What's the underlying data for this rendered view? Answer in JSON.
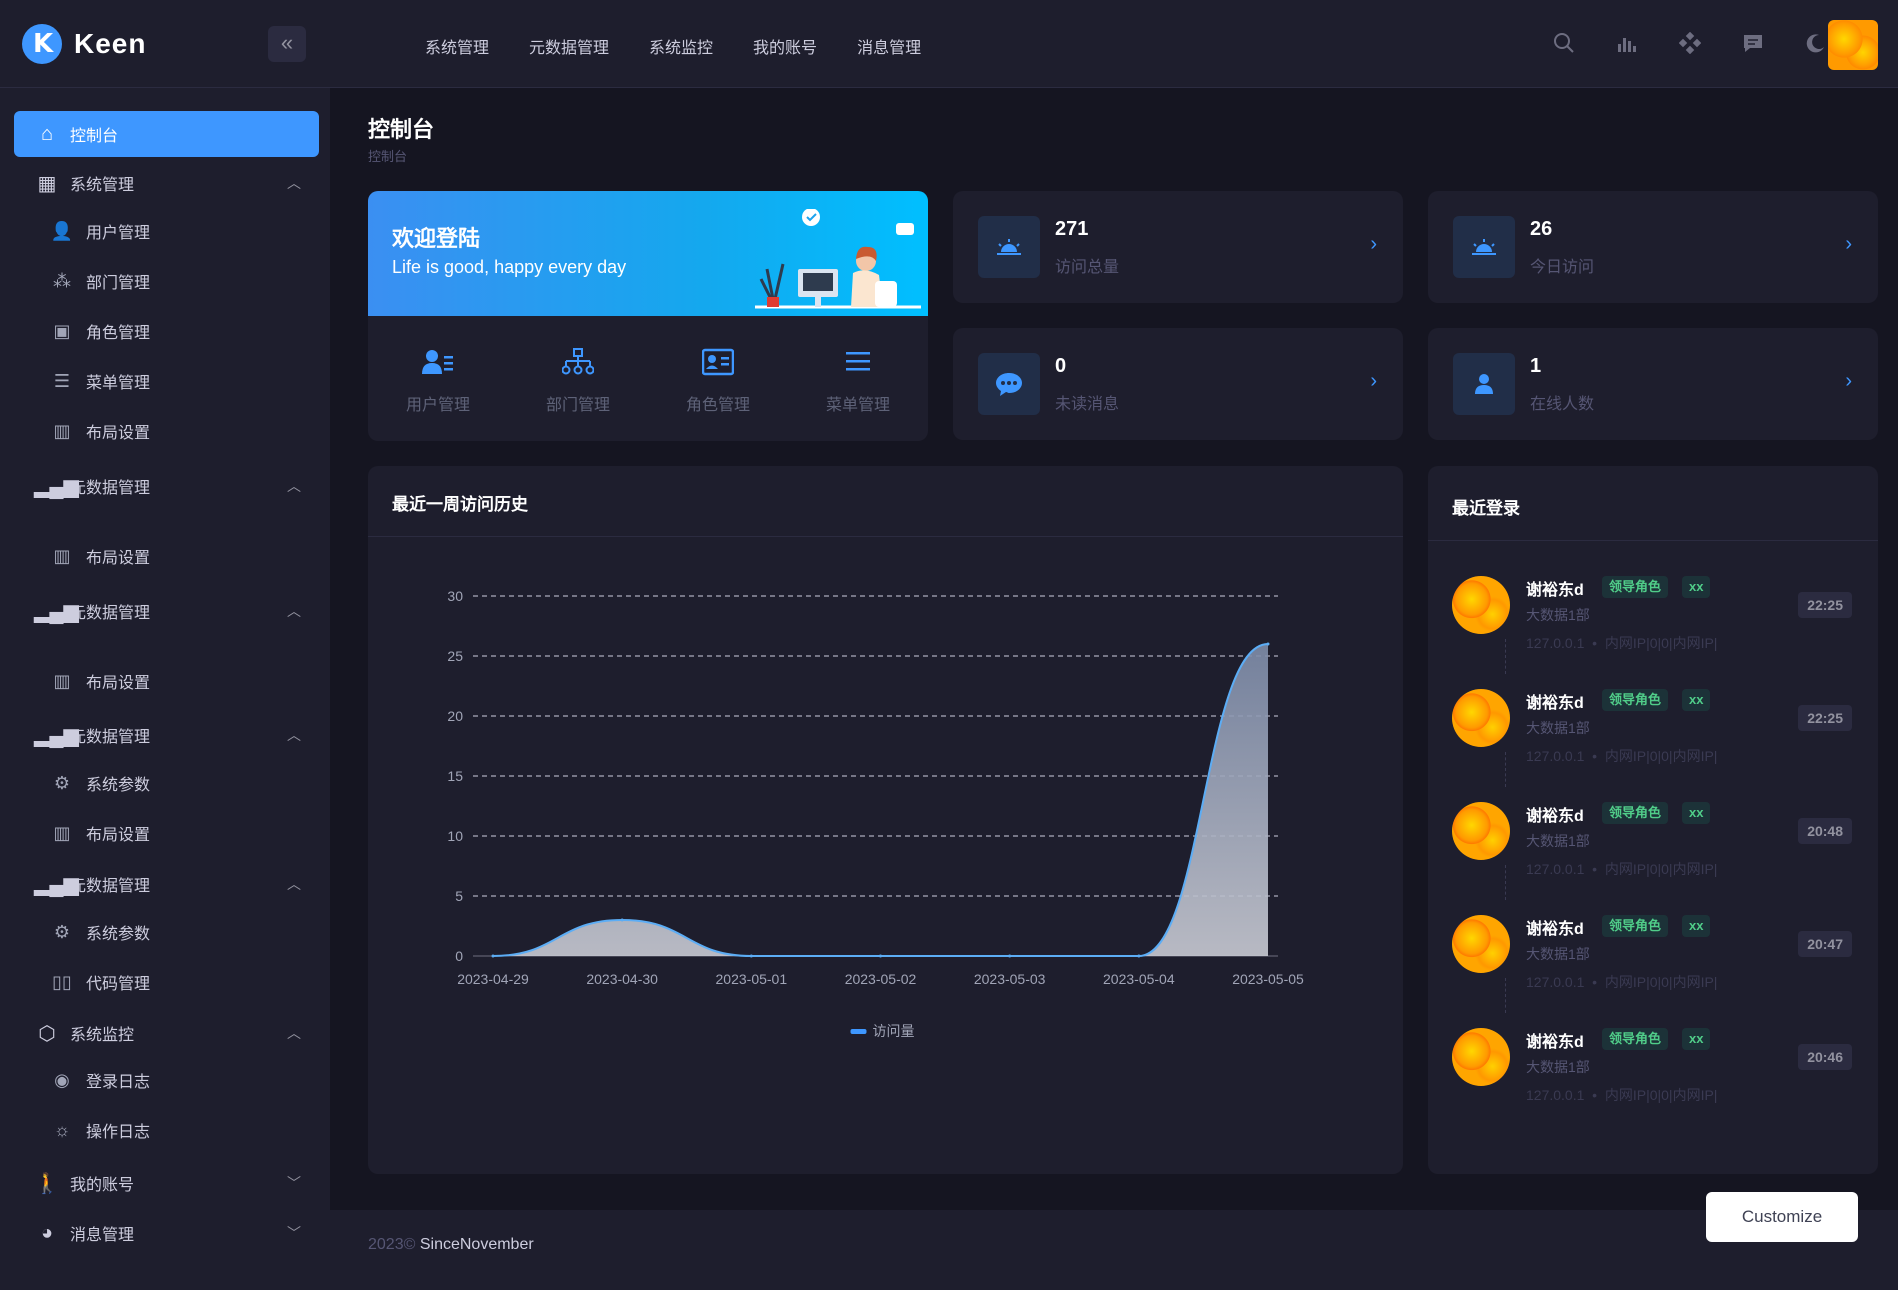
{
  "brand": {
    "name": "Keen",
    "accent": "#3e97ff"
  },
  "topnav": [
    "系统管理",
    "元数据管理",
    "系统监控",
    "我的账号",
    "消息管理"
  ],
  "top_icons": [
    "search-icon",
    "chart-icon",
    "apps-icon",
    "message-icon",
    "moon-icon"
  ],
  "sidebar": {
    "items": [
      {
        "label": "控制台",
        "icon": "home-icon",
        "active": true
      },
      {
        "label": "系统管理",
        "icon": "grid-icon",
        "expanded": true,
        "children": [
          {
            "label": "用户管理",
            "icon": "users-icon"
          },
          {
            "label": "部门管理",
            "icon": "org-icon"
          },
          {
            "label": "角色管理",
            "icon": "id-card-icon"
          },
          {
            "label": "菜单管理",
            "icon": "menu-icon"
          },
          {
            "label": "布局设置",
            "icon": "layout-icon"
          }
        ]
      },
      {
        "label": "元数据管理",
        "icon": "bar-chart-icon",
        "expanded": true,
        "children": [
          {
            "label": "布局设置",
            "icon": "layout-icon"
          }
        ]
      },
      {
        "label": "元数据管理",
        "icon": "bar-chart-icon",
        "expanded": true,
        "children": [
          {
            "label": "布局设置",
            "icon": "layout-icon"
          }
        ]
      },
      {
        "label": "元数据管理",
        "icon": "bar-chart-icon",
        "expanded": true,
        "children": [
          {
            "label": "系统参数",
            "icon": "gear-icon"
          },
          {
            "label": "布局设置",
            "icon": "layout-icon"
          }
        ]
      },
      {
        "label": "元数据管理",
        "icon": "bar-chart-icon",
        "expanded": true,
        "children": [
          {
            "label": "系统参数",
            "icon": "gear-icon"
          },
          {
            "label": "代码管理",
            "icon": "book-icon"
          }
        ]
      },
      {
        "label": "系统监控",
        "icon": "box-icon",
        "expanded": true,
        "children": [
          {
            "label": "登录日志",
            "icon": "fingerprint-icon"
          },
          {
            "label": "操作日志",
            "icon": "sunrise-icon"
          }
        ]
      },
      {
        "label": "我的账号",
        "icon": "person-icon",
        "expanded": false
      },
      {
        "label": "消息管理",
        "icon": "messenger-icon",
        "expanded": false
      }
    ]
  },
  "page": {
    "title": "控制台",
    "breadcrumb": "控制台"
  },
  "welcome": {
    "title": "欢迎登陆",
    "subtitle": "Life is good, happy every day",
    "quick_links": [
      {
        "label": "用户管理",
        "icon": "users-icon"
      },
      {
        "label": "部门管理",
        "icon": "org-icon"
      },
      {
        "label": "角色管理",
        "icon": "id-card-icon"
      },
      {
        "label": "菜单管理",
        "icon": "menu-icon"
      }
    ]
  },
  "stats": [
    {
      "value": "271",
      "label": "访问总量",
      "icon": "sunrise-icon"
    },
    {
      "value": "26",
      "label": "今日访问",
      "icon": "sunrise-icon"
    },
    {
      "value": "0",
      "label": "未读消息",
      "icon": "chat-icon"
    },
    {
      "value": "1",
      "label": "在线人数",
      "icon": "person-icon"
    }
  ],
  "chart_card": {
    "title": "最近一周访问历史"
  },
  "chart_data": {
    "type": "area",
    "title": "",
    "xlabel": "",
    "ylabel": "",
    "categories": [
      "2023-04-29",
      "2023-04-30",
      "2023-05-01",
      "2023-05-02",
      "2023-05-03",
      "2023-05-04",
      "2023-05-05"
    ],
    "series": [
      {
        "name": "访问量",
        "values": [
          0,
          3,
          0,
          0,
          0,
          0,
          26
        ]
      }
    ],
    "ylim": [
      0,
      30
    ],
    "yticks": [
      0,
      5,
      10,
      15,
      20,
      25,
      30
    ],
    "grid": true,
    "legend": "bottom",
    "line_color": "#5cadf5"
  },
  "logins": {
    "title": "最近登录",
    "rows": [
      {
        "name": "谢裕东d",
        "role": "领导角色",
        "tag": "xx",
        "dept": "大数据1部",
        "ip": "127.0.0.1",
        "location": "内网IP|0|0|内网IP|",
        "time": "22:25"
      },
      {
        "name": "谢裕东d",
        "role": "领导角色",
        "tag": "xx",
        "dept": "大数据1部",
        "ip": "127.0.0.1",
        "location": "内网IP|0|0|内网IP|",
        "time": "22:25"
      },
      {
        "name": "谢裕东d",
        "role": "领导角色",
        "tag": "xx",
        "dept": "大数据1部",
        "ip": "127.0.0.1",
        "location": "内网IP|0|0|内网IP|",
        "time": "20:48"
      },
      {
        "name": "谢裕东d",
        "role": "领导角色",
        "tag": "xx",
        "dept": "大数据1部",
        "ip": "127.0.0.1",
        "location": "内网IP|0|0|内网IP|",
        "time": "20:47"
      },
      {
        "name": "谢裕东d",
        "role": "领导角色",
        "tag": "xx",
        "dept": "大数据1部",
        "ip": "127.0.0.1",
        "location": "内网IP|0|0|内网IP|",
        "time": "20:46"
      }
    ]
  },
  "footer": {
    "year": "2023©",
    "brand": "SinceNovember"
  },
  "customize_label": "Customize"
}
